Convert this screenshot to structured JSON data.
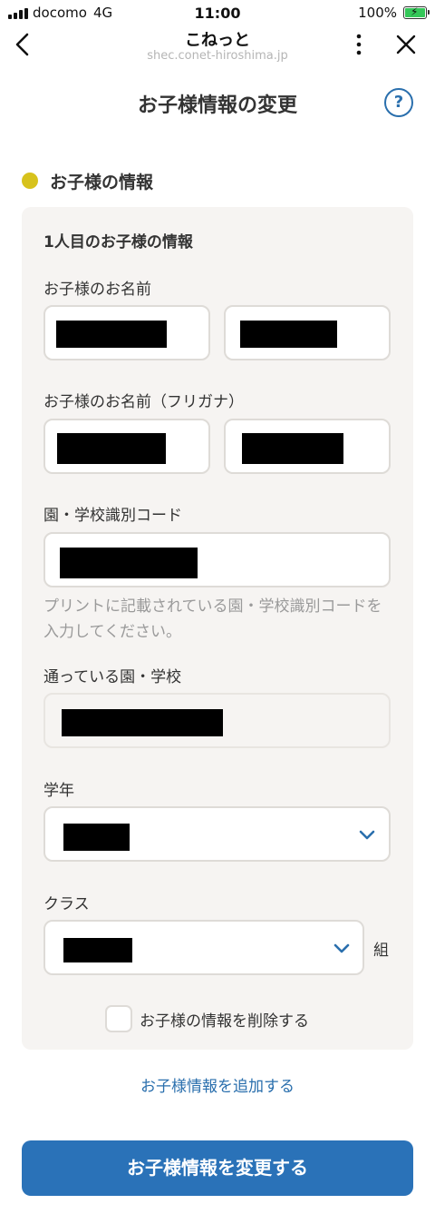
{
  "status_bar": {
    "carrier": "docomo",
    "network": "4G",
    "time": "11:00",
    "battery": "100%"
  },
  "browser": {
    "title": "こねっと",
    "url": "shec.conet-hiroshima.jp"
  },
  "page": {
    "title": "お子様情報の変更",
    "help_icon": "?"
  },
  "section": {
    "title": "お子様の情報",
    "dot_color": "#d7c21c"
  },
  "child_card": {
    "title": "1人目のお子様の情報",
    "name_label": "お子様のお名前",
    "kana_label": "お子様のお名前（フリガナ）",
    "school_code_label": "園・学校識別コード",
    "school_code_help": "プリントに記載されている園・学校識別コードを入力してください。",
    "school_label": "通っている園・学校",
    "grade_label": "学年",
    "class_label": "クラス",
    "class_suffix": "組",
    "delete_label": "お子様の情報を削除する"
  },
  "actions": {
    "add_child": "お子様情報を追加する",
    "submit": "お子様情報を変更する"
  },
  "colors": {
    "accent": "#2a72b8",
    "link": "#2a6fad",
    "card_bg": "#f6f4f2"
  }
}
